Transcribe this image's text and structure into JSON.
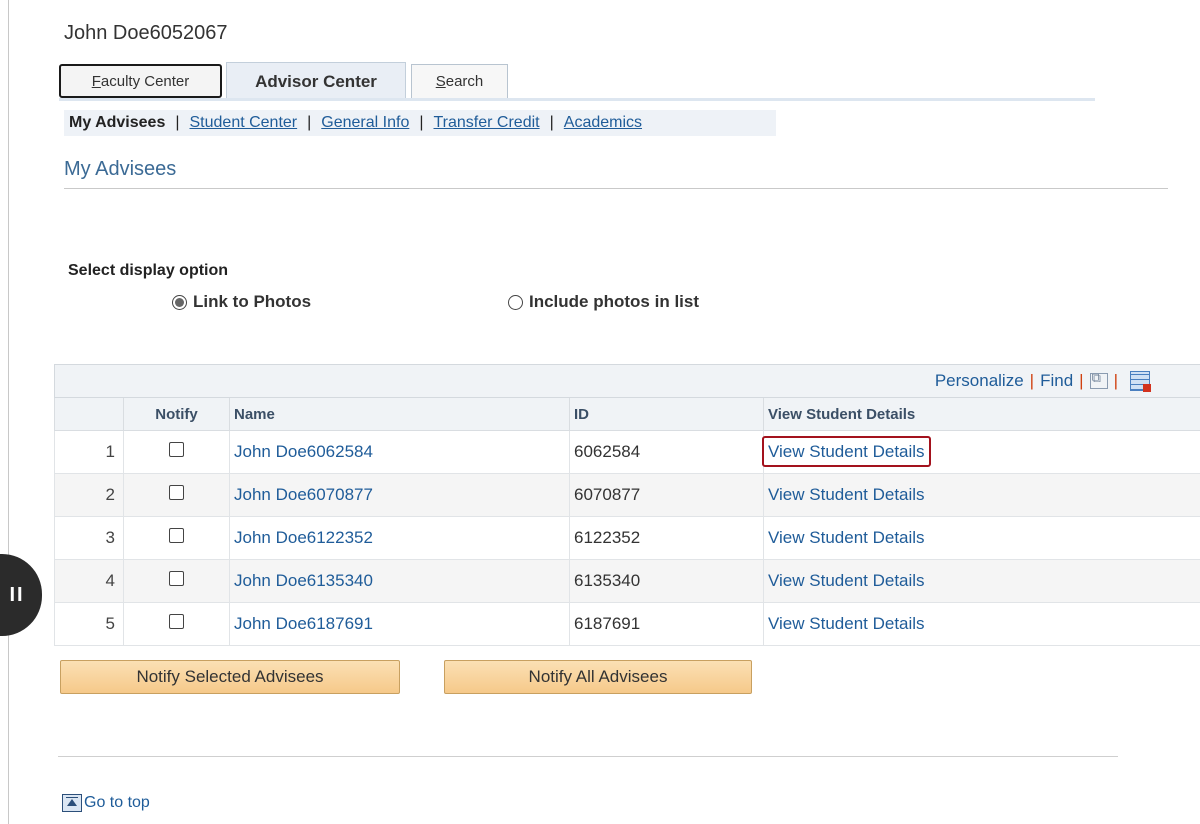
{
  "header": {
    "user_name": "John Doe6052067"
  },
  "tabs": [
    {
      "label": "Faculty Center",
      "underline": "F",
      "rest": "aculty Center"
    },
    {
      "label": "Advisor Center"
    },
    {
      "label": "Search",
      "underline": "S",
      "rest": "earch"
    }
  ],
  "subnav": {
    "current": "My Advisees",
    "links": [
      {
        "label": "Student Center"
      },
      {
        "label": "General Info"
      },
      {
        "label": "Transfer Credit"
      },
      {
        "label": "Academics"
      }
    ],
    "separator": "|"
  },
  "page_title": "My Advisees",
  "display_option": {
    "label": "Select display option",
    "options": [
      {
        "label": "Link to Photos",
        "selected": true
      },
      {
        "label": "Include photos in list",
        "selected": false
      }
    ]
  },
  "grid": {
    "toolbar": {
      "personalize": "Personalize",
      "find": "Find",
      "separator": "|"
    },
    "columns": [
      "",
      "Notify",
      "Name",
      "ID",
      "View Student Details"
    ],
    "rows": [
      {
        "num": "1",
        "name": "John Doe6062584",
        "id": "6062584",
        "details": "View Student Details",
        "notify": false
      },
      {
        "num": "2",
        "name": "John Doe6070877",
        "id": "6070877",
        "details": "View Student Details",
        "notify": false
      },
      {
        "num": "3",
        "name": "John Doe6122352",
        "id": "6122352",
        "details": "View Student Details",
        "notify": false
      },
      {
        "num": "4",
        "name": "John Doe6135340",
        "id": "6135340",
        "details": "View Student Details",
        "notify": false
      },
      {
        "num": "5",
        "name": "John Doe6187691",
        "id": "6187691",
        "details": "View Student Details",
        "notify": false
      }
    ]
  },
  "buttons": {
    "notify_selected": "Notify Selected Advisees",
    "notify_all": "Notify All Advisees"
  },
  "footer": {
    "go_to_top": "Go to top"
  },
  "colors": {
    "link": "#1f5c99",
    "focus_border": "#a3121d",
    "button_bg": "#f6c98a"
  }
}
